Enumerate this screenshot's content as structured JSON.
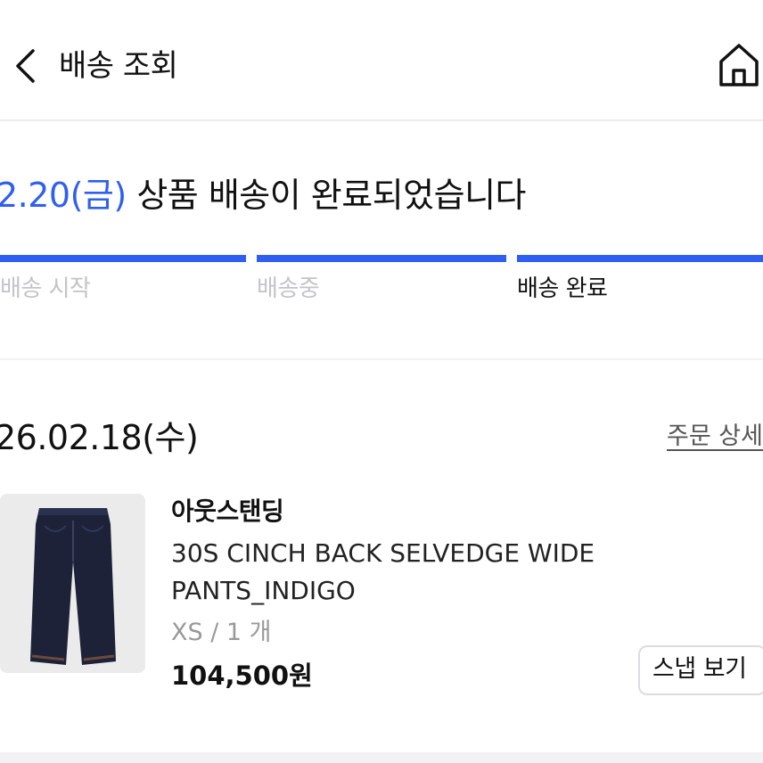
{
  "header": {
    "title": "배송 조회",
    "back_icon": "chevron-left-icon",
    "home_icon": "home-icon"
  },
  "status": {
    "date": "2.20(금)",
    "message": " 상품 배송이 완료되었습니다",
    "accent_color": "#2f5ff0",
    "steps": [
      {
        "label": "배송 시작",
        "done": true
      },
      {
        "label": "배송중",
        "done": true
      },
      {
        "label": "배송 완료",
        "done": true,
        "current": true
      }
    ]
  },
  "order": {
    "date": "26.02.18(수)",
    "detail_link": "주문 상세",
    "product": {
      "brand": "아웃스탠딩",
      "name": "30S CINCH BACK SELVEDGE WIDE PANTS_INDIGO",
      "option": "XS / 1 개",
      "price": "104,500원",
      "snap_button": "스냅 보기"
    }
  }
}
